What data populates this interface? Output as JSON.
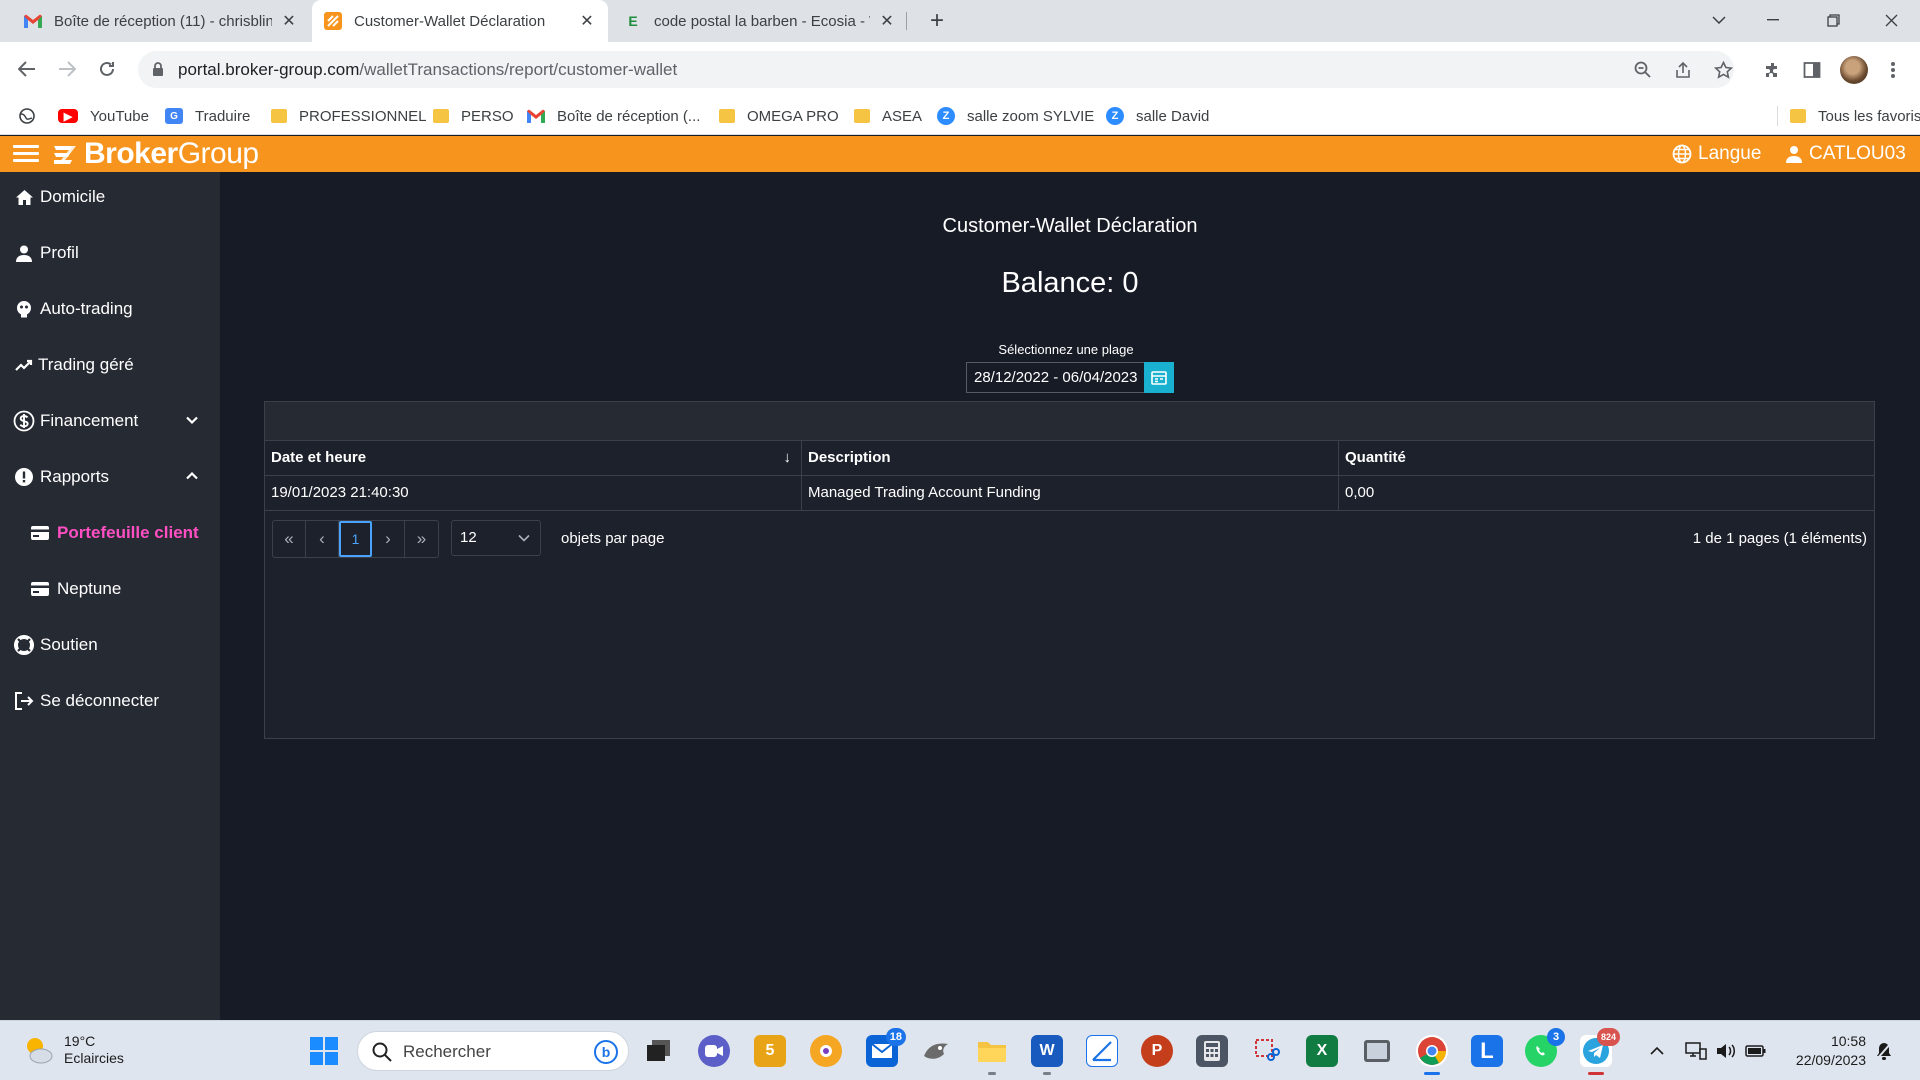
{
  "browser": {
    "tabs": [
      {
        "title": "Boîte de réception (11) - chrisblin",
        "favicon": "gmail-icon"
      },
      {
        "title": "Customer-Wallet Déclaration",
        "favicon": "brokergroup-icon"
      },
      {
        "title": "code postal la barben - Ecosia - W",
        "favicon": "ecosia-icon"
      }
    ],
    "url_host": "portal.broker-group.com",
    "url_path": "/walletTransactions/report/customer-wallet",
    "bookmarks": [
      {
        "label": "YouTube",
        "icon": "youtube-icon"
      },
      {
        "label": "Traduire",
        "icon": "translate-icon"
      },
      {
        "label": "PROFESSIONNEL",
        "icon": "folder-icon"
      },
      {
        "label": "PERSO",
        "icon": "folder-icon"
      },
      {
        "label": "Boîte de réception (...",
        "icon": "gmail-icon"
      },
      {
        "label": "OMEGA PRO",
        "icon": "folder-icon"
      },
      {
        "label": "ASEA",
        "icon": "folder-icon"
      },
      {
        "label": "salle zoom SYLVIE",
        "icon": "zoom-icon"
      },
      {
        "label": "salle David",
        "icon": "zoom-icon"
      }
    ],
    "all_bookmarks": "Tous les favoris"
  },
  "app": {
    "logo_bold": "Broker",
    "logo_light": "Group",
    "language": "Langue",
    "user": "CATLOU03",
    "colors": {
      "header": "#f7941d",
      "sidebar": "#252a33",
      "main": "#171b26",
      "active_menu": "#ff4fc3",
      "calendar_button": "#1ab0d0"
    }
  },
  "sidebar": {
    "items": [
      {
        "label": "Domicile",
        "icon": "home-icon"
      },
      {
        "label": "Profil",
        "icon": "user-icon"
      },
      {
        "label": "Auto-trading",
        "icon": "robot-icon"
      },
      {
        "label": "Trading géré",
        "icon": "chart-line-icon"
      },
      {
        "label": "Financement",
        "icon": "dollar-icon"
      },
      {
        "label": "Rapports",
        "icon": "alert-circle-icon"
      },
      {
        "label": "Portefeuille client",
        "icon": "wallet-icon"
      },
      {
        "label": "Neptune",
        "icon": "wallet-icon"
      },
      {
        "label": "Soutien",
        "icon": "lifebuoy-icon"
      },
      {
        "label": "Se déconnecter",
        "icon": "logout-icon"
      }
    ]
  },
  "main": {
    "title": "Customer-Wallet Déclaration",
    "balance": "Balance: 0",
    "range_label": "Sélectionnez une plage",
    "range_value": "28/12/2022 - 06/04/2023",
    "table": {
      "columns": [
        "Date et heure",
        "Description",
        "Quantité"
      ],
      "rows": [
        [
          "19/01/2023 21:40:30",
          "Managed Trading Account Funding",
          "0,00"
        ]
      ]
    },
    "pager": {
      "first": "«",
      "prev": "‹",
      "current": "1",
      "next": "›",
      "last": "»",
      "page_size": "12",
      "per_page_label": "objets par page",
      "info": "1 de 1 pages (1 éléments)"
    }
  },
  "taskbar": {
    "weather_temp": "19°C",
    "weather_desc": "Eclaircies",
    "search_placeholder": "Rechercher",
    "mail_badge": "18",
    "whatsapp_badge": "3",
    "telegram_badge": "824",
    "time": "10:58",
    "date": "22/09/2023"
  }
}
